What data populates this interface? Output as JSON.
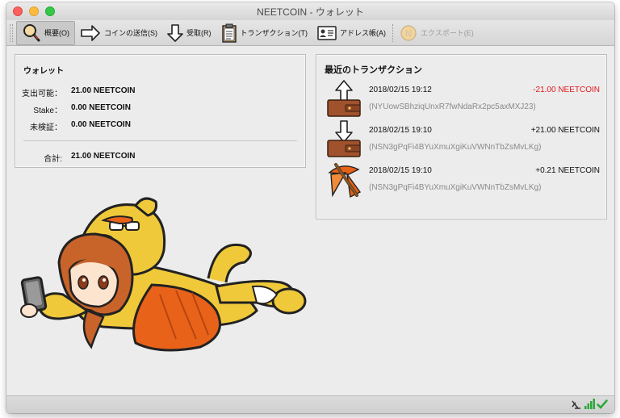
{
  "window": {
    "title": "NEETCOIN - ウォレット"
  },
  "toolbar": {
    "overview": "概要(O)",
    "send": "コインの送信(S)",
    "receive": "受取(R)",
    "transactions": "トランザクション(T)",
    "address_book": "アドレス帳(A)",
    "export": "エクスポート(E)"
  },
  "wallet": {
    "title": "ウォレット",
    "spendable_label": "支出可能：",
    "spendable_value": "21.00 NEETCOIN",
    "stake_label": "Stake：",
    "stake_value": "0.00 NEETCOIN",
    "unconfirmed_label": "未検証：",
    "unconfirmed_value": "0.00 NEETCOIN",
    "total_label": "合計:",
    "total_value": "21.00 NEETCOIN"
  },
  "recent": {
    "title": "最近のトランザクション",
    "items": [
      {
        "type": "sent-icon",
        "date": "2018/02/15 19:12",
        "amount": "-21.00 NEETCOIN",
        "address": "(NYUowSBhziqUnxR7fwNdaRx2pc5axMXJ23)",
        "color": "#e0191c"
      },
      {
        "type": "received-icon",
        "date": "2018/02/15 19:10",
        "amount": "+21.00 NEETCOIN",
        "address": "(NSN3gPqFi4BYuXmuXgiKuVWNnTbZsMvLKg)",
        "color": "#111111"
      },
      {
        "type": "mined-icon",
        "date": "2018/02/15 19:10",
        "amount": "+0.21 NEETCOIN",
        "address": "(NSN3gPqFi4BYuXmuXgiKuVWNnTbZsMvLKg)",
        "color": "#111111"
      }
    ]
  },
  "colors": {
    "negative": "#e0191c",
    "muted": "#8a8a8a",
    "wallet_brown": "#a0522d",
    "mascot_yellow": "#f0c93a",
    "mascot_orange": "#e8621a"
  }
}
